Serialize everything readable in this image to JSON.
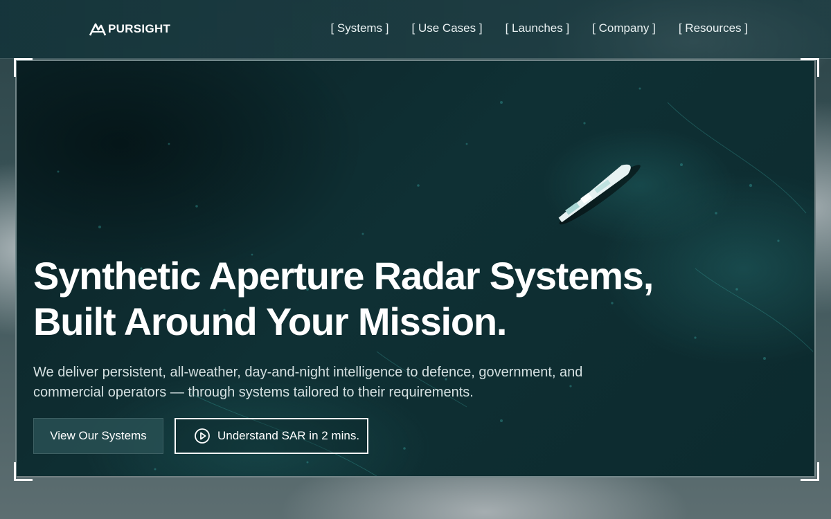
{
  "brand": {
    "name": "PURSIGHT"
  },
  "nav": {
    "links": [
      {
        "label": "[ Systems ]"
      },
      {
        "label": "[ Use Cases ]"
      },
      {
        "label": "[ Launches ]"
      },
      {
        "label": "[ Company ]"
      },
      {
        "label": "[ Resources ]"
      }
    ]
  },
  "hero": {
    "headline_line1": "Synthetic Aperture Radar Systems,",
    "headline_line2": "Built Around Your Mission.",
    "subtext": "We deliver persistent, all-weather, day-and-night intelligence to defence, government, and commercial operators — through systems tailored to their requirements.",
    "primary_button": "View Our Systems",
    "secondary_button": "Understand SAR in 2 mins.",
    "secondary_icon": "play-circle-icon"
  },
  "colors": {
    "nav_bg": "#14343a",
    "hero_bg": "#0f3034",
    "accent": "#ffffff",
    "button_bg": "#285054"
  }
}
